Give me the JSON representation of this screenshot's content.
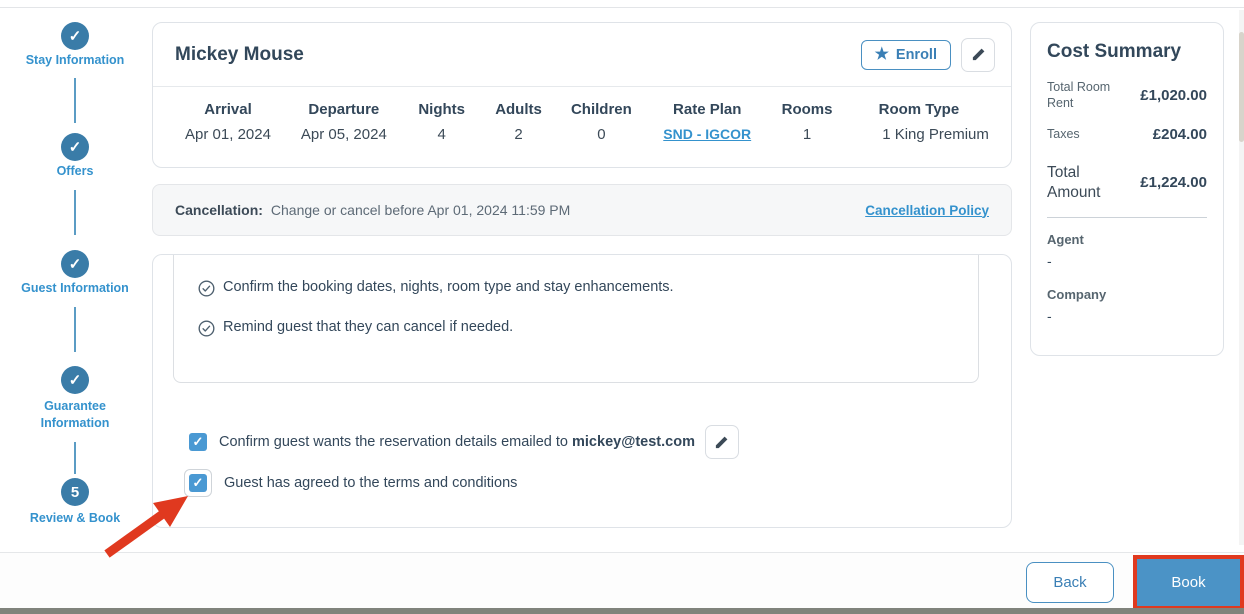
{
  "stepper": {
    "steps": [
      {
        "label": "Stay Information",
        "state": "done"
      },
      {
        "label": "Offers",
        "state": "done"
      },
      {
        "label": "Guest Information",
        "state": "done"
      },
      {
        "label": "Guarantee Information",
        "state": "done"
      },
      {
        "label": "Review & Book",
        "state": "current",
        "number": "5"
      }
    ],
    "check_glyph": "✓"
  },
  "guest": {
    "name": "Mickey Mouse",
    "enroll_label": "Enroll"
  },
  "booking_table": {
    "columns": [
      "Arrival",
      "Departure",
      "Nights",
      "Adults",
      "Children",
      "Rate Plan",
      "Rooms",
      "Room Type"
    ],
    "values": [
      "Apr 01, 2024",
      "Apr 05, 2024",
      "4",
      "2",
      "0",
      "SND - IGCOR",
      "1",
      "1 King Premium"
    ]
  },
  "cancellation": {
    "label": "Cancellation:",
    "text": "Change or cancel before Apr 01, 2024 11:59 PM",
    "policy_link": "Cancellation Policy"
  },
  "script_items": [
    "Confirm the booking dates, nights, room type and stay enhancements.",
    "Remind guest that they can cancel if needed."
  ],
  "confirmations": {
    "email_prefix": "Confirm guest wants the reservation details emailed to",
    "email": "mickey@test.com",
    "terms": "Guest has agreed to the terms and conditions"
  },
  "cost_summary": {
    "title": "Cost Summary",
    "rows": [
      {
        "label": "Total Room Rent",
        "value": "£1,020.00"
      },
      {
        "label": "Taxes",
        "value": "£204.00"
      },
      {
        "label": "Total Amount",
        "value": "£1,224.00"
      }
    ],
    "agent_label": "Agent",
    "agent_value": "-",
    "company_label": "Company",
    "company_value": "-"
  },
  "footer": {
    "back_label": "Back",
    "book_label": "Book"
  },
  "colors": {
    "primary_blue": "#3a7ca8",
    "link_blue": "#3492cd",
    "checkbox_blue": "#4a99d3",
    "book_button_blue": "#4b93c6",
    "annotation_red": "#e0391f",
    "dark_text": "#33475a"
  }
}
